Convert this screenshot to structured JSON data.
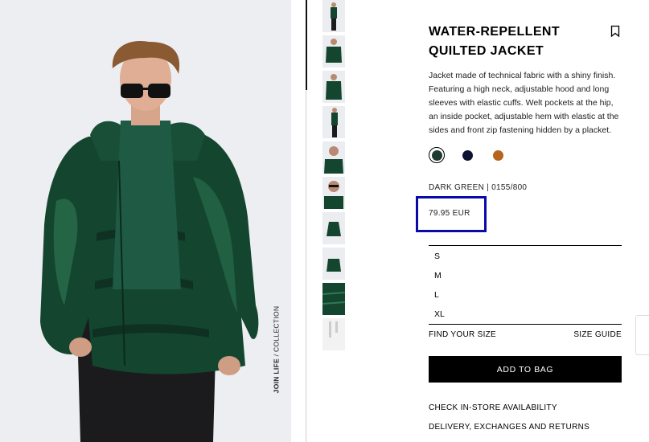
{
  "product": {
    "title": "WATER-REPELLENT QUILTED JACKET",
    "description": "Jacket made of technical fabric with a shiny finish. Featuring a high neck, adjustable hood and long sleeves with elastic cuffs. Welt pockets at the hip, an inside pocket, adjustable hem with elastic at the sides and front zip fastening hidden by a placket.",
    "color_ref": "DARK GREEN | 0155/800",
    "price": "79.95 EUR",
    "bookmark_icon": "bookmark-icon"
  },
  "swatches": [
    {
      "color": "#1f3a2e",
      "selected": true
    },
    {
      "color": "#0d1230",
      "selected": false
    },
    {
      "color": "#b5651d",
      "selected": false
    }
  ],
  "sizes": [
    "S",
    "M",
    "L",
    "XL"
  ],
  "links": {
    "find_size": "FIND YOUR SIZE",
    "size_guide": "SIZE GUIDE",
    "store_availability": "CHECK IN-STORE AVAILABILITY",
    "delivery": "DELIVERY, EXCHANGES AND RETURNS"
  },
  "cta": {
    "add_to_bag": "ADD TO BAG"
  },
  "collection": {
    "brand": "JOIN LIFE",
    "suffix": " / COLLECTION"
  },
  "colors": {
    "accent_highlight": "#0a0aa8",
    "jacket": "#14452f",
    "button": "#000000"
  },
  "thumbnails": [
    "model-full",
    "jacket-front",
    "jacket-worn",
    "model-side",
    "model-closeup",
    "model-glasses",
    "jacket-flat",
    "jacket-folded",
    "fabric-detail",
    "label-detail"
  ]
}
